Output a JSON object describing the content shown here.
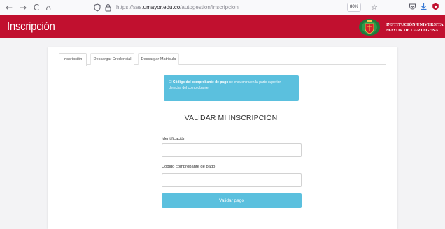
{
  "browser": {
    "back_icon": "←",
    "forward_icon": "→",
    "reload_icon": "C",
    "home_icon": "⌂",
    "url_prefix": "https://sas.",
    "url_domain": "umayor.edu.co",
    "url_path": "/autogestion/inscripcion",
    "zoom": "80%",
    "icons": [
      "shield-icon",
      "lock-icon",
      "star-icon",
      "pocket-icon",
      "download-icon",
      "extension-icon"
    ]
  },
  "header": {
    "title": "Inscripción",
    "institution_line1": "INSTITUCIÓN UNIVERSITA",
    "institution_line2": "MAYOR DE CARTAGENA",
    "brand_color": "#c1102f"
  },
  "tabs": [
    {
      "label": "Inscripción",
      "active": true
    },
    {
      "label": "Descargar Credencial",
      "active": false
    },
    {
      "label": "Descargar Matricula",
      "active": false
    }
  ],
  "alert": {
    "prefix": "El ",
    "bold": "Código del comprobante de pago",
    "rest": " se encuentra en la parte superior derecha del comprobante."
  },
  "form": {
    "title": "VALIDAR MI INSCRIPCIÓN",
    "id_label": "Identificación",
    "id_value": "",
    "code_label": "Código comprobante de pago",
    "code_value": "",
    "submit_label": "Validar pago",
    "accent_color": "#5bc0de"
  }
}
